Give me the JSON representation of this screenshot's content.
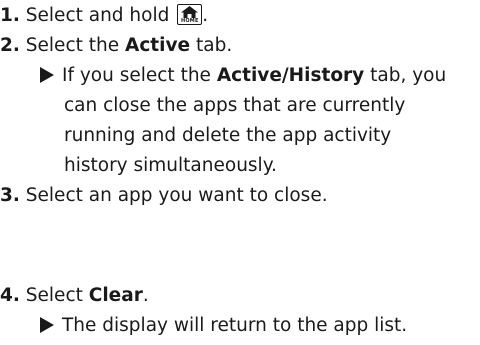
{
  "steps": [
    {
      "num": "1.",
      "pre": "Select and hold",
      "post": "."
    },
    {
      "num": "2.",
      "pre": "Select the",
      "bold": "Active",
      "post": "tab."
    },
    {
      "num": "3.",
      "text": "Select an app you want to close."
    },
    {
      "num": "4.",
      "pre": "Select",
      "bold": "Clear",
      "post": "."
    }
  ],
  "home_button": {
    "label": "HOME",
    "icon": "home-icon"
  },
  "note_step2": {
    "line1_pre": "If you select the",
    "line1_bold": "Active/History",
    "line1_post": "tab, you",
    "line2": "can close the apps that are currently",
    "line3": "running and delete the app activity",
    "line4": "history simultaneously."
  },
  "note_step4": {
    "text": "The display will return to the app list."
  }
}
